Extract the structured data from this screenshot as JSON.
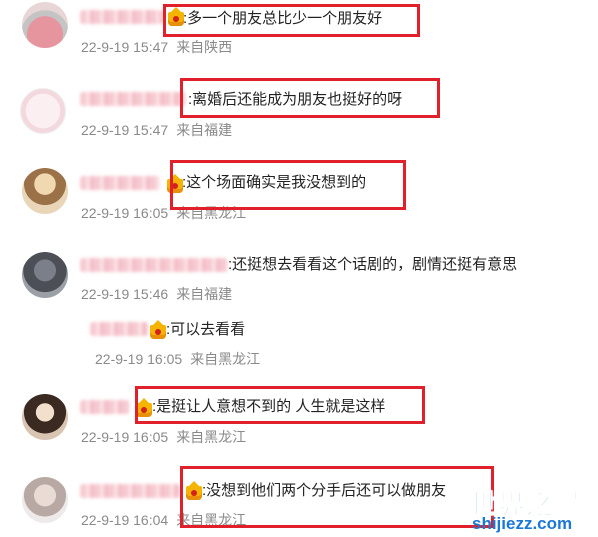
{
  "comments": [
    {
      "text": ":多一个朋友总比少一个朋友好",
      "time": "22-9-19 15:47",
      "location": "来自陕西"
    },
    {
      "text": ":离婚后还能成为朋友也挺好的呀",
      "time": "22-9-19 15:47",
      "location": "来自福建"
    },
    {
      "text": ":这个场面确实是我没想到的",
      "time": "22-9-19 16:05",
      "location": "来自黑龙江"
    },
    {
      "text": ":还挺想去看看这个话剧的，剧情还挺有意思",
      "time": "22-9-19 15:46",
      "location": "来自福建"
    },
    {
      "text": ":可以去看看",
      "time": "22-9-19 16:05",
      "location": "来自黑龙江"
    },
    {
      "text": ":是挺让人意想不到的 人生就是这样",
      "time": "22-9-19 16:05",
      "location": "来自黑龙江"
    },
    {
      "text": ":没想到他们两个分手后还可以做朋友",
      "time": "22-9-19 16:04",
      "location": "来自黑龙江"
    }
  ],
  "watermark": {
    "title": "世界之最",
    "url": "shijiezz.com"
  },
  "colors": {
    "highlight": "#e0212c",
    "brand": "#1a78d6",
    "meta": "#8a8a8a"
  }
}
